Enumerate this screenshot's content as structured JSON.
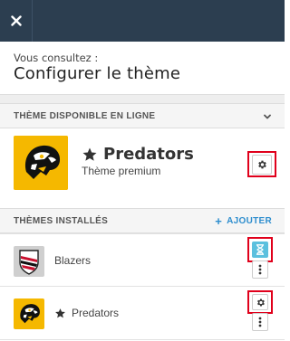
{
  "header": {
    "close_icon": "close-icon",
    "subtitle": "Vous consultez :",
    "title": "Configurer le thème"
  },
  "online_section": {
    "label": "THÈME DISPONIBLE EN LIGNE",
    "chevron_icon": "chevron-down-icon",
    "theme": {
      "name": "Predators",
      "subtitle": "Thème premium",
      "star_icon": "star-icon",
      "settings_icon": "gear-icon"
    }
  },
  "installed_section": {
    "label": "THÈMES INSTALLÉS",
    "add_label": "AJOUTER",
    "add_icon": "plus-icon",
    "items": [
      {
        "name": "Blazers",
        "action_icon": "hourglass-icon",
        "menu_icon": "vertical-dots-icon"
      },
      {
        "name": "Predators",
        "star_icon": "star-icon",
        "action_icon": "gear-icon",
        "menu_icon": "vertical-dots-icon"
      }
    ]
  },
  "colors": {
    "topbar": "#2c3e50",
    "accent_link": "#2e8ece",
    "highlight": "#e0001b",
    "hourglass_bg": "#5bc0de",
    "predators_yellow": "#f5b800"
  }
}
